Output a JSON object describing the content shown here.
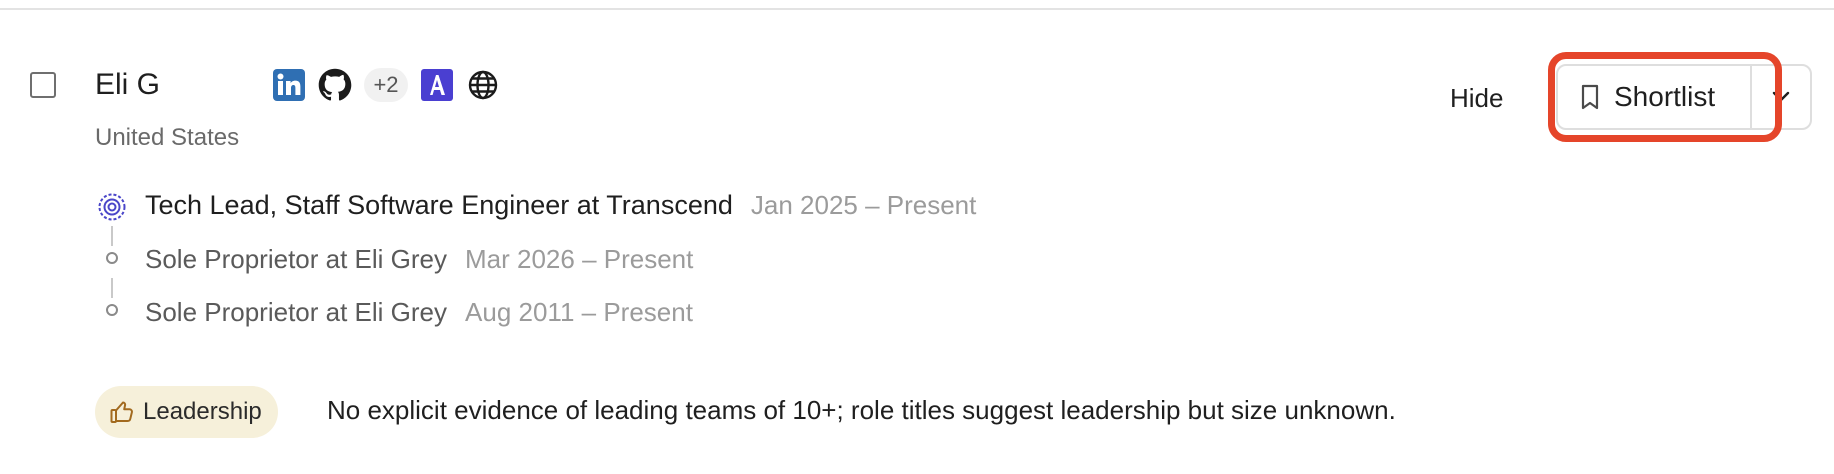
{
  "candidate": {
    "name": "Eli G",
    "location": "United States",
    "social": {
      "extra_count": "+2"
    }
  },
  "actions": {
    "hide_label": "Hide",
    "shortlist_label": "Shortlist"
  },
  "experience": [
    {
      "title": "Tech Lead, Staff Software Engineer at Transcend",
      "dates": "Jan 2025 – Present"
    },
    {
      "title": "Sole Proprietor at Eli Grey",
      "dates": "Mar 2026 – Present"
    },
    {
      "title": "Sole Proprietor at Eli Grey",
      "dates": "Aug 2011 – Present"
    }
  ],
  "evaluation": {
    "tag_label": "Leadership",
    "note": "No explicit evidence of leading teams of 10+; role titles suggest leadership but size unknown."
  },
  "colors": {
    "highlight": "#e5452a",
    "linkedin": "#2f6fb3",
    "angellist": "#4a3fd1",
    "tag_bg": "#f6f0da"
  }
}
